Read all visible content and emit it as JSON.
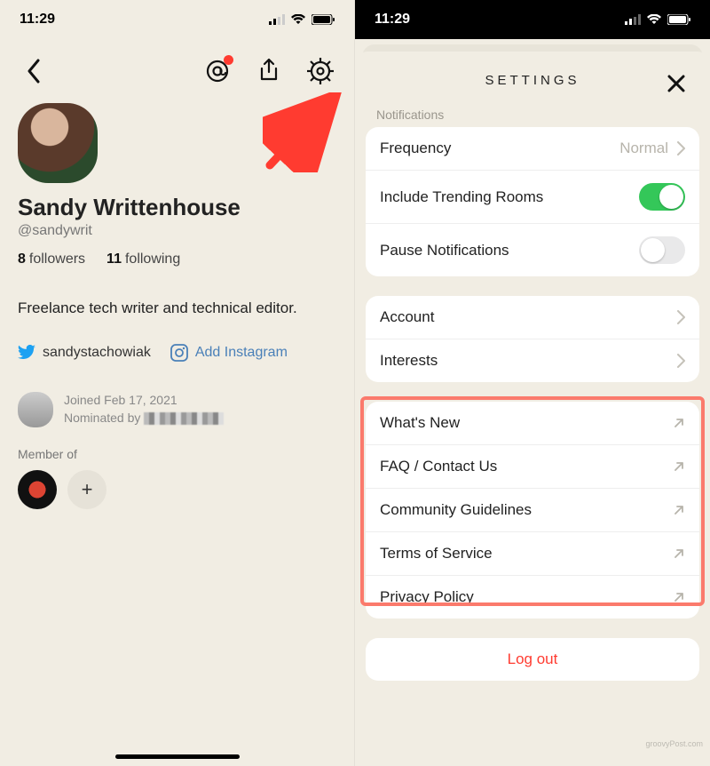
{
  "status": {
    "time": "11:29"
  },
  "profile": {
    "name": "Sandy Writtenhouse",
    "handle": "@sandywrit",
    "followers_count": "8",
    "followers_label": "followers",
    "following_count": "11",
    "following_label": "following",
    "bio": "Freelance tech writer and technical editor.",
    "twitter_handle": "sandystachowiak",
    "add_instagram_label": "Add Instagram",
    "joined_label": "Joined Feb 17, 2021",
    "nominated_label": "Nominated by",
    "member_of_label": "Member of"
  },
  "settings": {
    "title": "SETTINGS",
    "notifications_label": "Notifications",
    "rows": {
      "frequency_label": "Frequency",
      "frequency_value": "Normal",
      "trending_label": "Include Trending Rooms",
      "pause_label": "Pause Notifications",
      "account_label": "Account",
      "interests_label": "Interests",
      "whatsnew_label": "What's New",
      "faq_label": "FAQ / Contact Us",
      "guidelines_label": "Community Guidelines",
      "tos_label": "Terms of Service",
      "privacy_label": "Privacy Policy",
      "logout_label": "Log out"
    },
    "toggles": {
      "trending_on": true,
      "pause_on": false
    }
  },
  "watermark": "groovyPost.com"
}
